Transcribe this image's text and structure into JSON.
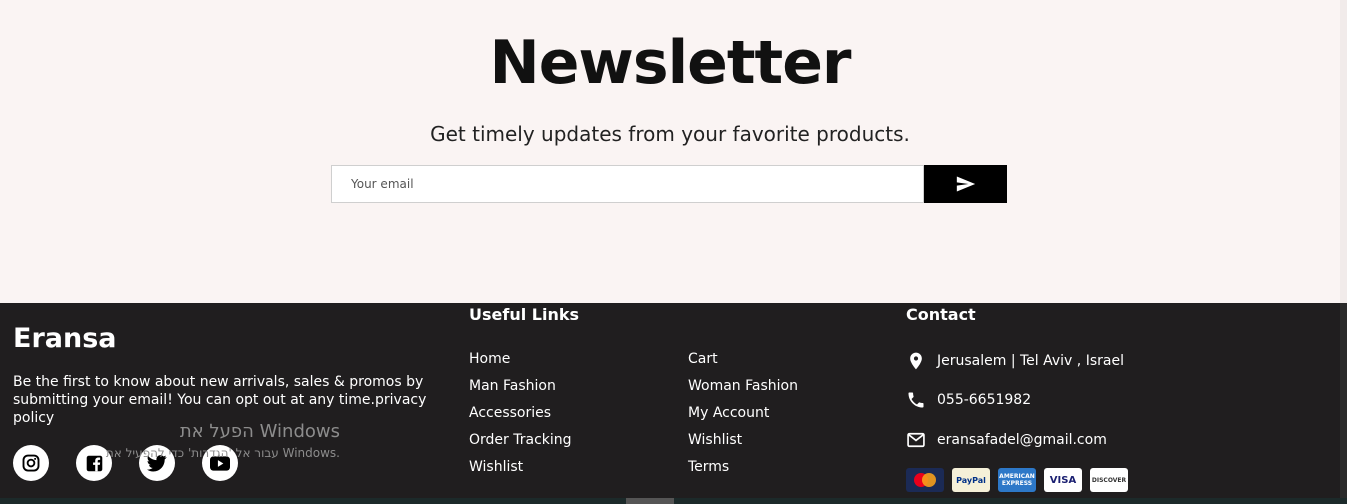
{
  "newsletter": {
    "title": "Newsletter",
    "subtitle": "Get timely updates from your favorite products.",
    "email_placeholder": "Your email",
    "send_icon": "send-icon"
  },
  "footer": {
    "brand": "Eransa",
    "brand_text": "Be the first to know about new arrivals, sales & promos by submitting your email! You can opt out at any time.privacy policy",
    "socials": [
      "instagram-icon",
      "facebook-icon",
      "twitter-icon",
      "youtube-icon"
    ],
    "useful_links": {
      "title": "Useful Links",
      "col1": [
        "Home",
        "Man Fashion",
        "Accessories",
        "Order Tracking",
        "Wishlist"
      ],
      "col2": [
        "Cart",
        "Woman Fashion",
        "My Account",
        "Wishlist",
        "Terms"
      ]
    },
    "contact": {
      "title": "Contact",
      "address": "Jerusalem | Tel Aviv , Israel",
      "phone": "055-6651982",
      "email": "eransafadel@gmail.com"
    },
    "payments": [
      "MasterCard",
      "PayPal",
      "AMERICAN EXPRESS",
      "VISA",
      "DISCOVER"
    ]
  },
  "watermark": {
    "line1": "הפעל את Windows",
    "line2": "עבור אל 'הגדרות' כדי להפעיל את Windows."
  }
}
